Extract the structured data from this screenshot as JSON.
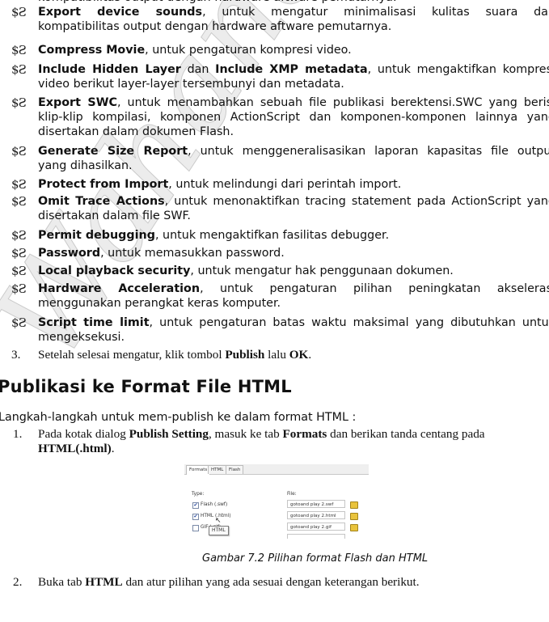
{
  "partial_top_line": "kompatibilitas output dengan hardware aftware pemutarnya.",
  "bullet_glyph": "$Ƨ",
  "bullets": [
    {
      "term": "Export device sounds",
      "rest": ", untuk mengatur minimalisasi kulitas suara dan",
      "cont": [
        "kompatibilitas output dengan hardware aftware pemutarnya."
      ]
    },
    {
      "term": "Compress Movie",
      "rest": ", untuk pengaturan kompresi video.",
      "cont": []
    },
    {
      "term": "Include Hidden Layer",
      "mid": " dan ",
      "term2": "Include XMP metadata",
      "rest": ", untuk mengaktifkan kompresi",
      "cont": [
        "video berikut layer-layer tersembunyi dan metadata."
      ]
    },
    {
      "term": "Export SWC",
      "rest": ", untuk menambahkan sebuah file publikasi berektensi.SWC yang berisi",
      "cont": [
        "klip-klip kompilasi, komponen ActionScript dan komponen-komponen lainnya yang",
        "disertakan dalam dokumen Flash."
      ]
    },
    {
      "term": "Generate Size Report",
      "rest": ", untuk menggeneralisasikan laporan kapasitas file output",
      "cont": [
        "yang dihasilkan."
      ]
    },
    {
      "term": "Protect from Import",
      "rest": ", untuk melindungi dari perintah import.",
      "cont": []
    },
    {
      "term": "Omit Trace Actions",
      "rest": ", untuk menonaktifkan tracing statement pada ActionScript yang",
      "cont": [
        "disertakan dalam file SWF."
      ]
    },
    {
      "term": "Permit debugging",
      "rest": ", untuk mengaktifkan fasilitas debugger.",
      "cont": []
    },
    {
      "term": "Password",
      "rest": ", untuk memasukkan password.",
      "cont": []
    },
    {
      "term": "Local playback security",
      "rest": ", untuk mengatur hak penggunaan dokumen.",
      "cont": []
    },
    {
      "term": "Hardware Acceleration",
      "rest": ", untuk pengaturan pilihan peningkatan akselerasi",
      "cont": [
        "menggunakan perangkat keras komputer."
      ]
    },
    {
      "term": "Script time limit",
      "rest": ", untuk pengaturan batas waktu maksimal yang dibutuhkan untuk",
      "cont": [
        "mengeksekusi."
      ]
    }
  ],
  "step3": {
    "num": "3.",
    "pre": "Setelah selesai mengatur, klik tombol ",
    "b1": "Publish",
    "mid": " lalu ",
    "b2": "OK",
    "post": "."
  },
  "section_heading": "Publikasi ke Format File HTML",
  "intro": "Langkah-langkah untuk mem-publish ke dalam format HTML :",
  "step1": {
    "num": "1.",
    "pre": "Pada kotak dialog ",
    "b1": "Publish Setting",
    "mid": ", masuk ke tab ",
    "b2": "Formats",
    "post": " dan berikan tanda centang pada",
    "line2_b": "HTML(.html)",
    "line2_post": "."
  },
  "figure": {
    "tabs": [
      "Formats",
      "HTML",
      "Flash"
    ],
    "active_tab": "Formats",
    "type_label": "Type:",
    "file_label": "File:",
    "rows": [
      {
        "label": "Flash  (.swf)",
        "checked": true,
        "file": "gotoand play 2.swf"
      },
      {
        "label": "HTML  (.html)",
        "checked": true,
        "file": "gotoand play 2.html"
      },
      {
        "label": "GIF  (.gif)",
        "checked": false,
        "file": "gotoand play 2.gif"
      }
    ],
    "tooltip": "HTML",
    "check_mark": "✔",
    "cursor": "↖"
  },
  "caption": "Gambar 7.2 Pilihan format Flash dan HTML",
  "step2": {
    "num": "2.",
    "pre": "Buka tab ",
    "b1": "HTML",
    "post": " dan atur pilihan yang ada sesuai dengan keterangan berikut."
  },
  "watermark": "Wahana Training"
}
